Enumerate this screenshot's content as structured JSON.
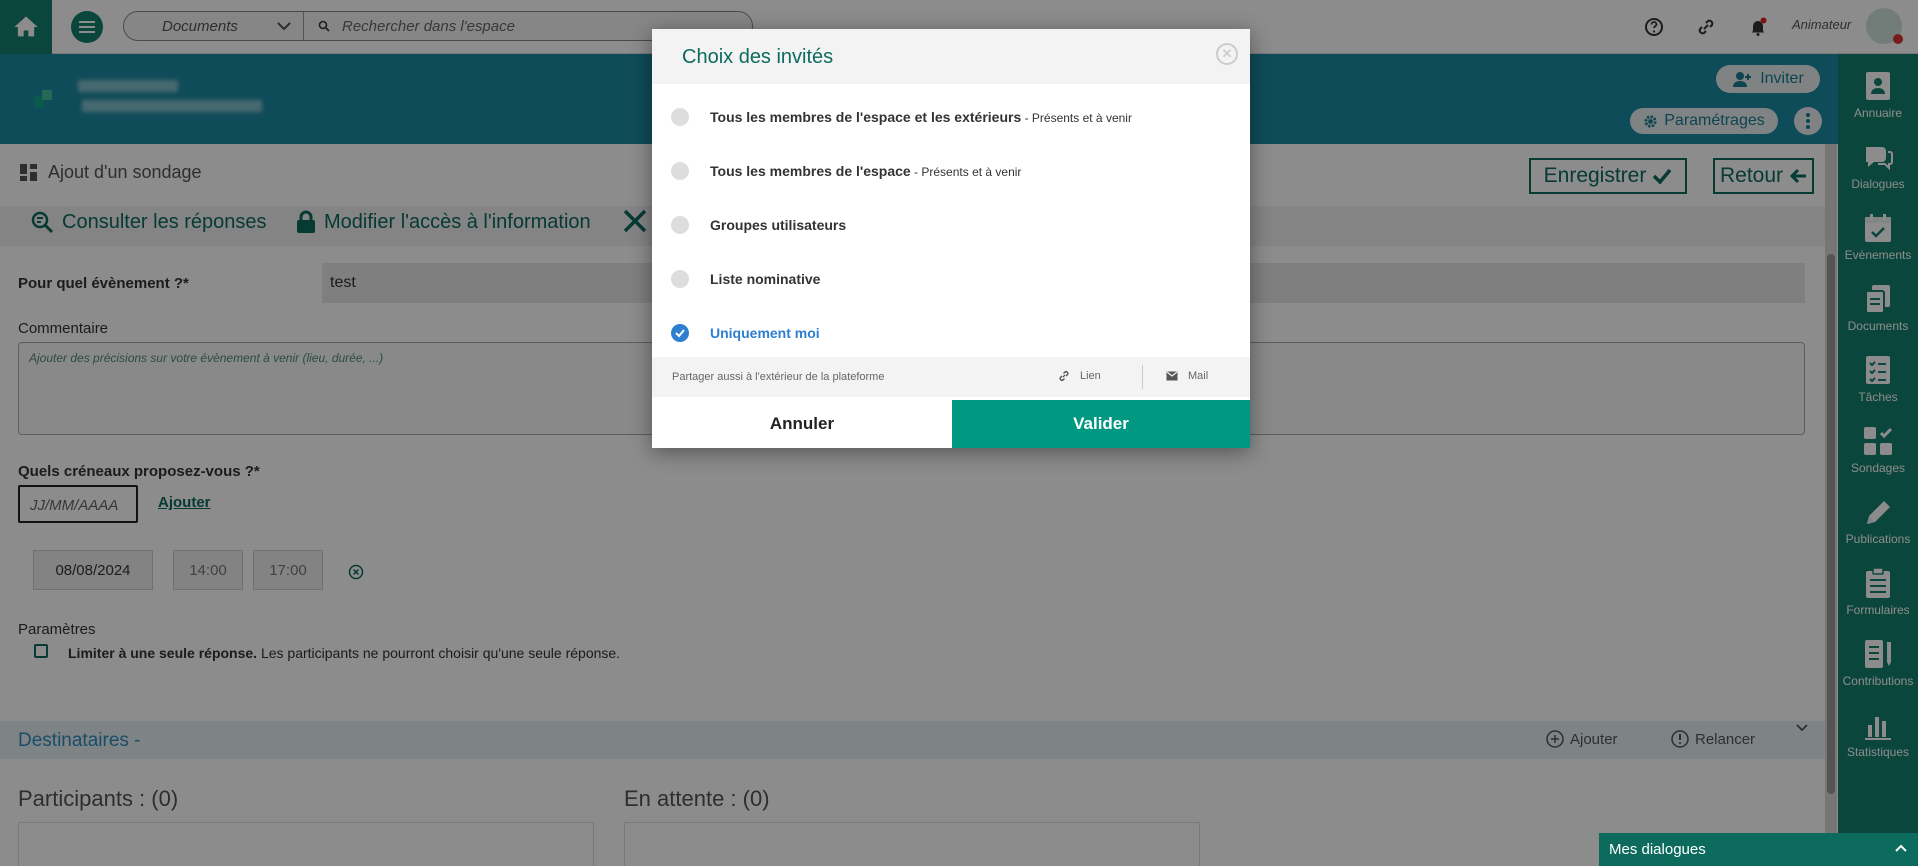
{
  "topbar": {
    "search_scope": "Documents",
    "search_placeholder": "Rechercher dans l'espace",
    "user_role": "Animateur",
    "icons": [
      "help-icon",
      "link-icon",
      "bell-icon"
    ]
  },
  "space_header": {
    "invite_label": "Inviter",
    "settings_label": "Paramétrages"
  },
  "sidebar": {
    "items": [
      {
        "label": "Annuaire",
        "icon": "contact-book-icon"
      },
      {
        "label": "Dialogues",
        "icon": "chat-icon"
      },
      {
        "label": "Evènements",
        "icon": "calendar-icon"
      },
      {
        "label": "Documents",
        "icon": "documents-icon"
      },
      {
        "label": "Tâches",
        "icon": "tasks-icon"
      },
      {
        "label": "Sondages",
        "icon": "poll-icon"
      },
      {
        "label": "Publications",
        "icon": "pencil-icon"
      },
      {
        "label": "Formulaires",
        "icon": "form-icon"
      },
      {
        "label": "Contributions",
        "icon": "contribution-icon"
      },
      {
        "label": "Statistiques",
        "icon": "stats-icon"
      }
    ]
  },
  "page": {
    "title": "Ajout d'un sondage",
    "save_label": "Enregistrer",
    "back_label": "Retour",
    "tabs": [
      "Consulter les réponses",
      "Modifier l'accès à l'information"
    ],
    "event_label": "Pour quel évènement ?*",
    "event_value": "test",
    "comment_label": "Commentaire",
    "comment_placeholder": "Ajouter des précisions sur votre évènement à venir (lieu, durée, ...)",
    "slots_label": "Quels créneaux proposez-vous ?*",
    "date_placeholder": "JJ/MM/AAAA",
    "add_label": "Ajouter",
    "slot": {
      "date": "08/08/2024",
      "start": "14:00",
      "end": "17:00"
    },
    "params_label": "Paramètres",
    "limit_bold": "Limiter à une seule réponse.",
    "limit_text": " Les participants ne pourront choisir qu'une seule réponse.",
    "recipients_title": "Destinataires -",
    "recipients_add": "Ajouter",
    "recipients_remind": "Relancer",
    "participants": "Participants : (0)",
    "pending": "En attente : (0)"
  },
  "dialogs_bar": {
    "label": "Mes dialogues"
  },
  "modal": {
    "title": "Choix des invités",
    "options": [
      {
        "label": "Tous les membres de l'espace et les extérieurs",
        "sub": " - Présents et à venir",
        "selected": false
      },
      {
        "label": "Tous les membres de l'espace",
        "sub": " - Présents et à venir",
        "selected": false
      },
      {
        "label": "Groupes utilisateurs",
        "sub": "",
        "selected": false
      },
      {
        "label": "Liste nominative",
        "sub": "",
        "selected": false
      },
      {
        "label": "Uniquement moi",
        "sub": "",
        "selected": true
      }
    ],
    "share_text": "Partager aussi à l'extérieur de la plateforme",
    "share_link": "Lien",
    "share_mail": "Mail",
    "cancel_label": "Annuler",
    "confirm_label": "Valider"
  },
  "colors": {
    "primary": "#14806f",
    "header": "#1d8aa3",
    "confirm": "#009880",
    "selected": "#2e7fd0"
  }
}
